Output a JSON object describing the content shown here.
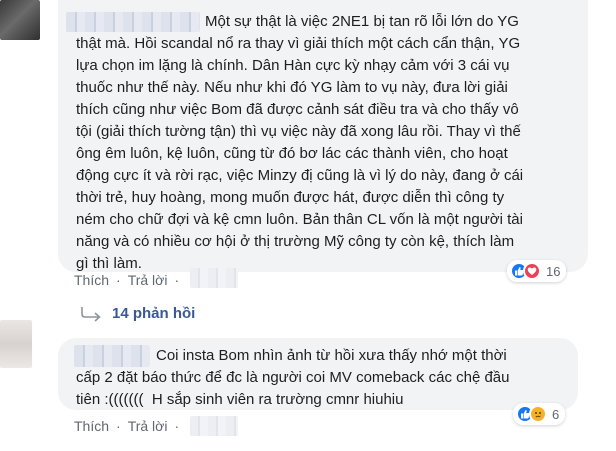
{
  "comments": [
    {
      "text": "Một sự thật là việc 2NE1 bị tan rõ lỗi lớn do YG\nthật mà. Hồi scandal nổ ra thay vì giải thích một cách cẩn thận, YG\nlựa chọn im lặng là chính. Dân Hàn cực kỳ nhạy cảm với 3 cái vụ\nthuốc như thế này. Nếu như khi đó YG làm to vụ này, đưa lời giải\nthích cũng như việc Bom đã được cảnh sát điều tra và cho thấy vô\ntội (giải thích tường tận) thì vụ việc này đã xong lâu rồi. Thay vì thế\nông êm luôn, kệ luôn, cũng từ đó bơ lác các thành viên, cho hoạt\nđộng cực ít và rời rạc, việc Minzy đị cũng là vì lý do này, đang ở cái\nthời trẻ, huy hoàng, mong muốn được hát, được diễn thì công ty\nném cho chữ đợi và kệ cmn luôn. Bản thân CL vốn là một người tài\nnăng và có nhiều cơ hội ở thị trường Mỹ công ty còn kệ, thích làm\ngì thì làm.",
      "like_label": "Thích",
      "reply_label": "Trả lời",
      "reaction_count": "16",
      "reactions": [
        "like-icon",
        "love-icon"
      ]
    },
    {
      "text": "Coi insta Bom nhìn ảnh từ hồi xưa thấy nhớ một thời\ncấp 2 đặt báo thức để đc là người coi MV comeback các chệ đầu\ntiên :(((((((  H sắp sinh viên ra trường cmnr hiuhiu",
      "like_label": "Thích",
      "reply_label": "Trả lời",
      "reaction_count": "6",
      "reactions": [
        "like-icon",
        "sad-icon"
      ]
    }
  ],
  "replies_link": {
    "label": "14 phản hồi"
  },
  "colors": {
    "bubble": "#f2f3f5",
    "link": "#385898",
    "meta": "#606770",
    "like": "#1877f2",
    "love": "#f33e58",
    "sad": "#f7b125"
  }
}
